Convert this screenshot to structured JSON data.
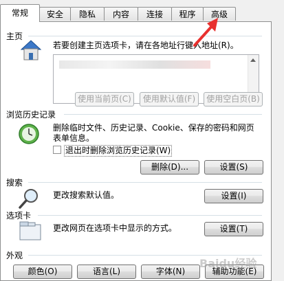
{
  "tabs": [
    {
      "label": "常规",
      "active": true
    },
    {
      "label": "安全"
    },
    {
      "label": "隐私"
    },
    {
      "label": "内容"
    },
    {
      "label": "连接"
    },
    {
      "label": "程序"
    },
    {
      "label": "高级"
    }
  ],
  "home": {
    "title": "主页",
    "desc": "若要创建主页选项卡，请在各地址行键入地址(R)。",
    "btn_current": "使用当前页(C)",
    "btn_default": "使用默认值(F)",
    "btn_blank": "使用空白页(B)"
  },
  "history": {
    "title": "浏览历史记录",
    "desc1": "删除临时文件、历史记录、Cookie、保存的密码和网页",
    "desc2": "表单信息。",
    "checkbox_label": "退出时删除浏览历史记录(W)",
    "btn_delete": "删除(D)...",
    "btn_settings": "设置(S)"
  },
  "search": {
    "title": "搜索",
    "desc": "更改搜索默认值。",
    "btn_settings": "设置(I)"
  },
  "tabs_section": {
    "title": "选项卡",
    "desc": "更改网页在选项卡中显示的方式。",
    "btn_settings": "设置(T)"
  },
  "appearance": {
    "title": "外观",
    "btn_colors": "颜色(O)",
    "btn_languages": "语言(L)",
    "btn_fonts": "字体(N)",
    "btn_accessibility": "辅助功能(E)"
  },
  "watermark": "Baidu经验"
}
